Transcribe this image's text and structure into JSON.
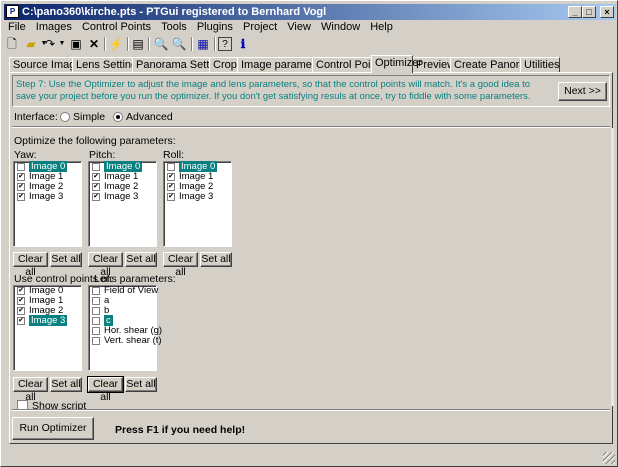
{
  "window": {
    "title": "C:\\pano360\\kirche.pts - PTGui registered to Bernhard Vogl",
    "app_icon": "ptgui-app-icon"
  },
  "titlebar_buttons": {
    "minimize": "_",
    "maximize": "□",
    "close": "×"
  },
  "menu": [
    "File",
    "Images",
    "Control Points",
    "Tools",
    "Plugins",
    "Project",
    "View",
    "Window",
    "Help"
  ],
  "toolbar": {
    "icons": [
      "new-file-icon",
      "open-folder-icon",
      "dropdown-arrow-icon",
      "redo-icon",
      "dropdown-arrow-icon",
      "save-icon",
      "close-x-icon",
      "wand-icon",
      "properties-icon",
      "zoom-in-icon",
      "zoom-out-icon",
      "panorama-icon",
      "help-icon",
      "info-icon"
    ]
  },
  "tabs": [
    {
      "label": "Source Images",
      "active": false
    },
    {
      "label": "Lens Settings",
      "active": false
    },
    {
      "label": "Panorama Settings",
      "active": false
    },
    {
      "label": "Crop",
      "active": false
    },
    {
      "label": "Image parameters",
      "active": false
    },
    {
      "label": "Control Points",
      "active": false
    },
    {
      "label": "Optimizer",
      "active": true
    },
    {
      "label": "Preview",
      "active": false
    },
    {
      "label": "Create Panorama",
      "active": false
    },
    {
      "label": "Utilities",
      "active": false
    }
  ],
  "info": {
    "text": "Step 7: Use the Optimizer to adjust the image and lens parameters, so that the control points will match. It's a good idea to save your project before you run the optimizer. If you don't get satisfying resuls at once, try to fiddle with some parameters.",
    "next_label": "Next >>"
  },
  "interface": {
    "label": "Interface:",
    "simple": "Simple",
    "advanced": "Advanced",
    "selected": "Advanced"
  },
  "optimize_label": "Optimize the following parameters:",
  "yaw": {
    "label": "Yaw:",
    "items": [
      {
        "name": "Image 0",
        "checked": false,
        "selected": true
      },
      {
        "name": "Image 1",
        "checked": true,
        "selected": false
      },
      {
        "name": "Image 2",
        "checked": true,
        "selected": false
      },
      {
        "name": "Image 3",
        "checked": true,
        "selected": false
      }
    ]
  },
  "pitch": {
    "label": "Pitch:",
    "items": [
      {
        "name": "Image 0",
        "checked": false,
        "selected": true
      },
      {
        "name": "Image 1",
        "checked": true,
        "selected": false
      },
      {
        "name": "Image 2",
        "checked": true,
        "selected": false
      },
      {
        "name": "Image 3",
        "checked": true,
        "selected": false
      }
    ]
  },
  "roll": {
    "label": "Roll:",
    "items": [
      {
        "name": "Image 0",
        "checked": false,
        "selected": true
      },
      {
        "name": "Image 1",
        "checked": true,
        "selected": false
      },
      {
        "name": "Image 2",
        "checked": true,
        "selected": false
      },
      {
        "name": "Image 3",
        "checked": true,
        "selected": false
      }
    ]
  },
  "control_points": {
    "label": "Use control points of:",
    "items": [
      {
        "name": "Image 0",
        "checked": true,
        "selected": false
      },
      {
        "name": "Image 1",
        "checked": true,
        "selected": false
      },
      {
        "name": "Image 2",
        "checked": true,
        "selected": false
      },
      {
        "name": "Image 3",
        "checked": true,
        "selected": true
      }
    ]
  },
  "lens": {
    "label": "Lens parameters:",
    "items": [
      {
        "name": "Field of View",
        "checked": false,
        "selected": false
      },
      {
        "name": "a",
        "checked": false,
        "selected": false
      },
      {
        "name": "b",
        "checked": false,
        "selected": false
      },
      {
        "name": "c",
        "checked": false,
        "selected": true
      },
      {
        "name": "Hor. shear (g)",
        "checked": false,
        "selected": false
      },
      {
        "name": "Vert. shear (t)",
        "checked": false,
        "selected": false
      }
    ]
  },
  "buttons": {
    "clear_all": "Clear all",
    "set_all": "Set all",
    "run_optimizer": "Run Optimizer"
  },
  "show_script": "Show script",
  "help_hint": "Press F1 if you need help!"
}
